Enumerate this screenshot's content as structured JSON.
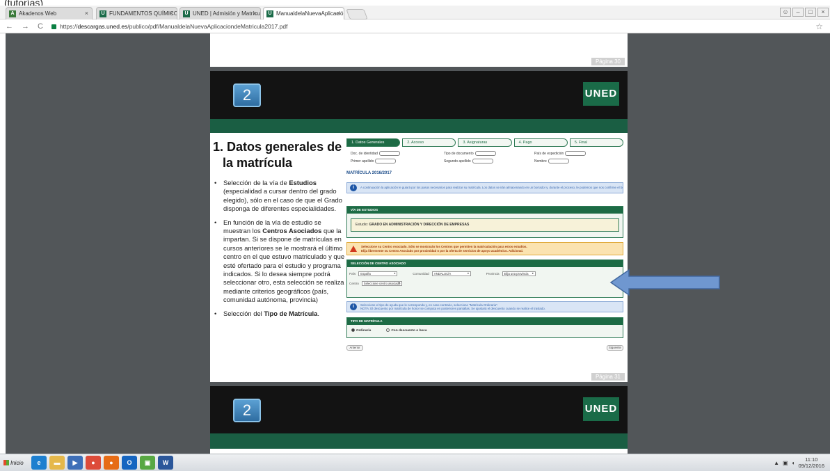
{
  "caption": "(tutorías)",
  "browser": {
    "tabs": [
      {
        "label": "Akadenos Web",
        "fav": "A",
        "color": "#3b7a3b"
      },
      {
        "label": "FUNDAMENTOS QUÍMICOS",
        "fav": "U",
        "color": "#1a6b48"
      },
      {
        "label": "UNED | Admisión y Matrícul",
        "fav": "U",
        "color": "#1a6b48"
      },
      {
        "label": "ManualdelaNuevaAplicación",
        "fav": "U",
        "color": "#1a6b48"
      }
    ],
    "url_scheme": "https://",
    "url_host": "descargas.uned.es",
    "url_path": "/publico/pdf/ManualdelaNuevaAplicaciondeMatricula2017.pdf"
  },
  "pdf": {
    "page_prev_num": "Página 30",
    "page_num": "Página 31",
    "badge": "2",
    "logo": "UNED",
    "title_line1": "1. Datos generales de",
    "title_line2": "la matrícula",
    "bullets": [
      {
        "pre": "Selección de la vía de ",
        "bold": "Estudios",
        "post": " (especialidad a cursar dentro del grado elegido), sólo en el caso de que el Grado disponga de diferentes especialidades."
      },
      {
        "pre": "En función de la vía de estudio se muestran los ",
        "bold": "Centros Asociados",
        "post": " que la impartan. Si se dispone de matrículas en cursos anteriores se le mostrará el último centro en el que estuvo matriculado y que esté ofertado para el estudio y programa indicados. Si lo desea siempre podrá seleccionar otro, esta selección se realiza mediante criterios geográficos (país, comunidad autónoma, provincia)"
      },
      {
        "pre": "Selección del ",
        "bold": "Tipo de Matrícula",
        "post": "."
      }
    ],
    "screenshot": {
      "steps": [
        "1. Datos Generales",
        "2. Acceso",
        "3. Asignaturas",
        "4. Pago",
        "5. Final"
      ],
      "fields": {
        "doc": "Doc. de identidad",
        "primer": "Primer apellido",
        "tipo": "Tipo de documento",
        "segundo": "Segundo apellido",
        "pais": "País de expedición",
        "nombre": "Nombre"
      },
      "matricula": "MATRÍCULA 2016/2017",
      "info1": "A continuación la aplicación le guiará por los pasos necesarios para realizar su matrícula. Los datos se irán almacenando en un borrador y, durante el proceso, le podemos que nos confirme el borrador. Si no lo hace, no se habrá matriculado.",
      "via_header": "VÍA DE ESTUDIOS",
      "estudio_label": "Estudio",
      "estudio_value": "GRADO EN ADMINISTRACIÓN Y DIRECCIÓN DE EMPRESAS",
      "warn_line1": "Seleccione su Centro Asociado. Sólo se mostrarán los Centros que permiten la matriculación para estos estudios.",
      "warn_line2": "Elija libremente su Centro Asociado por proximidad o por la oferta de servicios de apoyo académico. Adicional.",
      "centro_header": "SELECCIÓN DE CENTRO ASOCIADO",
      "pais_label": "País",
      "pais_value": "España",
      "comunidad_label": "Comunidad",
      "comunidad_value": "ANDALUCÍA",
      "provincia_label": "Provincia",
      "provincia_value": "Elija una provincia",
      "centro_label": "Centro",
      "centro_value": "Seleccione centro asociado",
      "info2_line1": "Seleccione el tipo de ayuda que le corresponda y, en caso contrario, seleccione \"Matrícula Ordinaria\".",
      "info2_line2": "NOTA: El descuento por matrícula de honor se computa en posteriores pantallas. Se ajustará el descuento cuando se realice el traslado.",
      "tipo_header": "TIPO DE MATRÍCULA",
      "radio1": "Ordinaria",
      "radio2": "Con descuento o beca",
      "btn_prev": "Anterior",
      "btn_next": "Siguiente"
    }
  },
  "taskbar": {
    "start": "Inicio",
    "time": "11:10",
    "date": "09/12/2016"
  }
}
